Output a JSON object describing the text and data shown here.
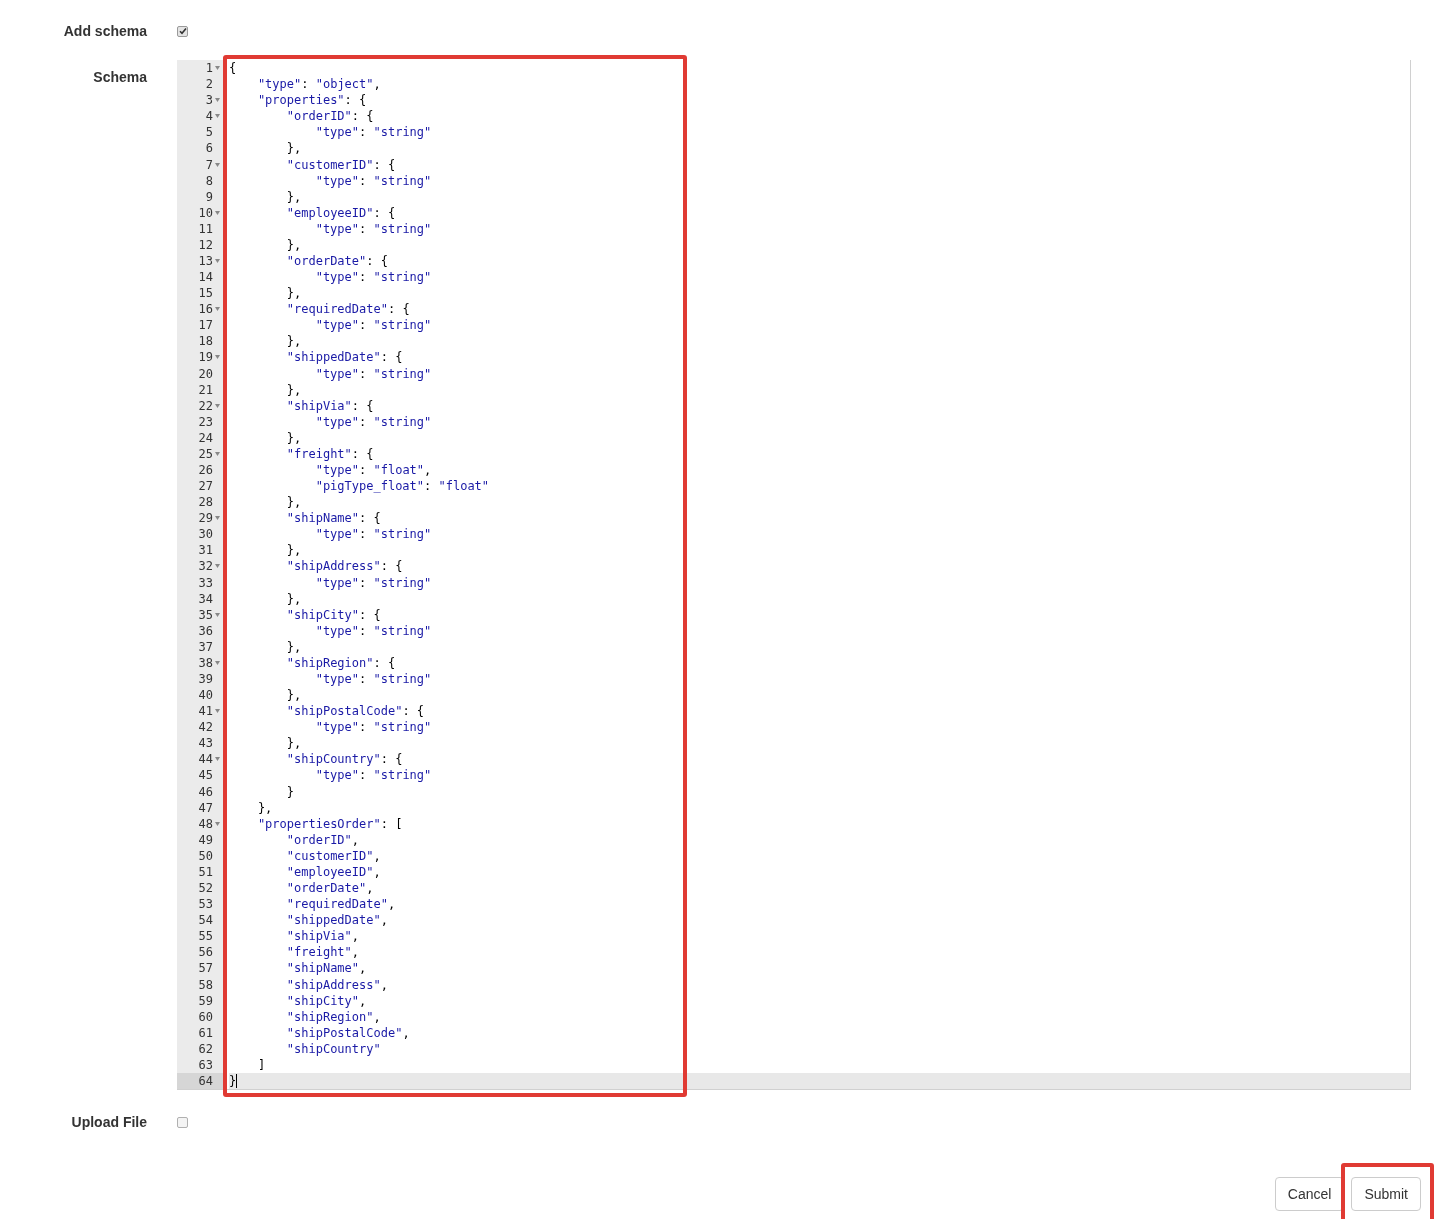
{
  "add_schema": {
    "label": "Add schema",
    "checked": true
  },
  "schema": {
    "label": "Schema",
    "lines": [
      {
        "number": "1",
        "text": "{",
        "foldable": true,
        "active": false
      },
      {
        "number": "2",
        "text": "    \"type\": \"object\",",
        "foldable": false,
        "active": false
      },
      {
        "number": "3",
        "text": "    \"properties\": {",
        "foldable": true,
        "active": false
      },
      {
        "number": "4",
        "text": "        \"orderID\": {",
        "foldable": true,
        "active": false
      },
      {
        "number": "5",
        "text": "            \"type\": \"string\"",
        "foldable": false,
        "active": false
      },
      {
        "number": "6",
        "text": "        },",
        "foldable": false,
        "active": false
      },
      {
        "number": "7",
        "text": "        \"customerID\": {",
        "foldable": true,
        "active": false
      },
      {
        "number": "8",
        "text": "            \"type\": \"string\"",
        "foldable": false,
        "active": false
      },
      {
        "number": "9",
        "text": "        },",
        "foldable": false,
        "active": false
      },
      {
        "number": "10",
        "text": "        \"employeeID\": {",
        "foldable": true,
        "active": false
      },
      {
        "number": "11",
        "text": "            \"type\": \"string\"",
        "foldable": false,
        "active": false
      },
      {
        "number": "12",
        "text": "        },",
        "foldable": false,
        "active": false
      },
      {
        "number": "13",
        "text": "        \"orderDate\": {",
        "foldable": true,
        "active": false
      },
      {
        "number": "14",
        "text": "            \"type\": \"string\"",
        "foldable": false,
        "active": false
      },
      {
        "number": "15",
        "text": "        },",
        "foldable": false,
        "active": false
      },
      {
        "number": "16",
        "text": "        \"requiredDate\": {",
        "foldable": true,
        "active": false
      },
      {
        "number": "17",
        "text": "            \"type\": \"string\"",
        "foldable": false,
        "active": false
      },
      {
        "number": "18",
        "text": "        },",
        "foldable": false,
        "active": false
      },
      {
        "number": "19",
        "text": "        \"shippedDate\": {",
        "foldable": true,
        "active": false
      },
      {
        "number": "20",
        "text": "            \"type\": \"string\"",
        "foldable": false,
        "active": false
      },
      {
        "number": "21",
        "text": "        },",
        "foldable": false,
        "active": false
      },
      {
        "number": "22",
        "text": "        \"shipVia\": {",
        "foldable": true,
        "active": false
      },
      {
        "number": "23",
        "text": "            \"type\": \"string\"",
        "foldable": false,
        "active": false
      },
      {
        "number": "24",
        "text": "        },",
        "foldable": false,
        "active": false
      },
      {
        "number": "25",
        "text": "        \"freight\": {",
        "foldable": true,
        "active": false
      },
      {
        "number": "26",
        "text": "            \"type\": \"float\",",
        "foldable": false,
        "active": false
      },
      {
        "number": "27",
        "text": "            \"pigType_float\": \"float\"",
        "foldable": false,
        "active": false
      },
      {
        "number": "28",
        "text": "        },",
        "foldable": false,
        "active": false
      },
      {
        "number": "29",
        "text": "        \"shipName\": {",
        "foldable": true,
        "active": false
      },
      {
        "number": "30",
        "text": "            \"type\": \"string\"",
        "foldable": false,
        "active": false
      },
      {
        "number": "31",
        "text": "        },",
        "foldable": false,
        "active": false
      },
      {
        "number": "32",
        "text": "        \"shipAddress\": {",
        "foldable": true,
        "active": false
      },
      {
        "number": "33",
        "text": "            \"type\": \"string\"",
        "foldable": false,
        "active": false
      },
      {
        "number": "34",
        "text": "        },",
        "foldable": false,
        "active": false
      },
      {
        "number": "35",
        "text": "        \"shipCity\": {",
        "foldable": true,
        "active": false
      },
      {
        "number": "36",
        "text": "            \"type\": \"string\"",
        "foldable": false,
        "active": false
      },
      {
        "number": "37",
        "text": "        },",
        "foldable": false,
        "active": false
      },
      {
        "number": "38",
        "text": "        \"shipRegion\": {",
        "foldable": true,
        "active": false
      },
      {
        "number": "39",
        "text": "            \"type\": \"string\"",
        "foldable": false,
        "active": false
      },
      {
        "number": "40",
        "text": "        },",
        "foldable": false,
        "active": false
      },
      {
        "number": "41",
        "text": "        \"shipPostalCode\": {",
        "foldable": true,
        "active": false
      },
      {
        "number": "42",
        "text": "            \"type\": \"string\"",
        "foldable": false,
        "active": false
      },
      {
        "number": "43",
        "text": "        },",
        "foldable": false,
        "active": false
      },
      {
        "number": "44",
        "text": "        \"shipCountry\": {",
        "foldable": true,
        "active": false
      },
      {
        "number": "45",
        "text": "            \"type\": \"string\"",
        "foldable": false,
        "active": false
      },
      {
        "number": "46",
        "text": "        }",
        "foldable": false,
        "active": false
      },
      {
        "number": "47",
        "text": "    },",
        "foldable": false,
        "active": false
      },
      {
        "number": "48",
        "text": "    \"propertiesOrder\": [",
        "foldable": true,
        "active": false
      },
      {
        "number": "49",
        "text": "        \"orderID\",",
        "foldable": false,
        "active": false
      },
      {
        "number": "50",
        "text": "        \"customerID\",",
        "foldable": false,
        "active": false
      },
      {
        "number": "51",
        "text": "        \"employeeID\",",
        "foldable": false,
        "active": false
      },
      {
        "number": "52",
        "text": "        \"orderDate\",",
        "foldable": false,
        "active": false
      },
      {
        "number": "53",
        "text": "        \"requiredDate\",",
        "foldable": false,
        "active": false
      },
      {
        "number": "54",
        "text": "        \"shippedDate\",",
        "foldable": false,
        "active": false
      },
      {
        "number": "55",
        "text": "        \"shipVia\",",
        "foldable": false,
        "active": false
      },
      {
        "number": "56",
        "text": "        \"freight\",",
        "foldable": false,
        "active": false
      },
      {
        "number": "57",
        "text": "        \"shipName\",",
        "foldable": false,
        "active": false
      },
      {
        "number": "58",
        "text": "        \"shipAddress\",",
        "foldable": false,
        "active": false
      },
      {
        "number": "59",
        "text": "        \"shipCity\",",
        "foldable": false,
        "active": false
      },
      {
        "number": "60",
        "text": "        \"shipRegion\",",
        "foldable": false,
        "active": false
      },
      {
        "number": "61",
        "text": "        \"shipPostalCode\",",
        "foldable": false,
        "active": false
      },
      {
        "number": "62",
        "text": "        \"shipCountry\"",
        "foldable": false,
        "active": false
      },
      {
        "number": "63",
        "text": "    ]",
        "foldable": false,
        "active": false
      },
      {
        "number": "64",
        "text": "}",
        "foldable": false,
        "active": true
      }
    ]
  },
  "upload_file": {
    "label": "Upload File",
    "checked": false
  },
  "buttons": [
    {
      "label": "Cancel",
      "highlighted": false
    },
    {
      "label": "Submit",
      "highlighted": true
    }
  ],
  "editor_highlighted": true
}
